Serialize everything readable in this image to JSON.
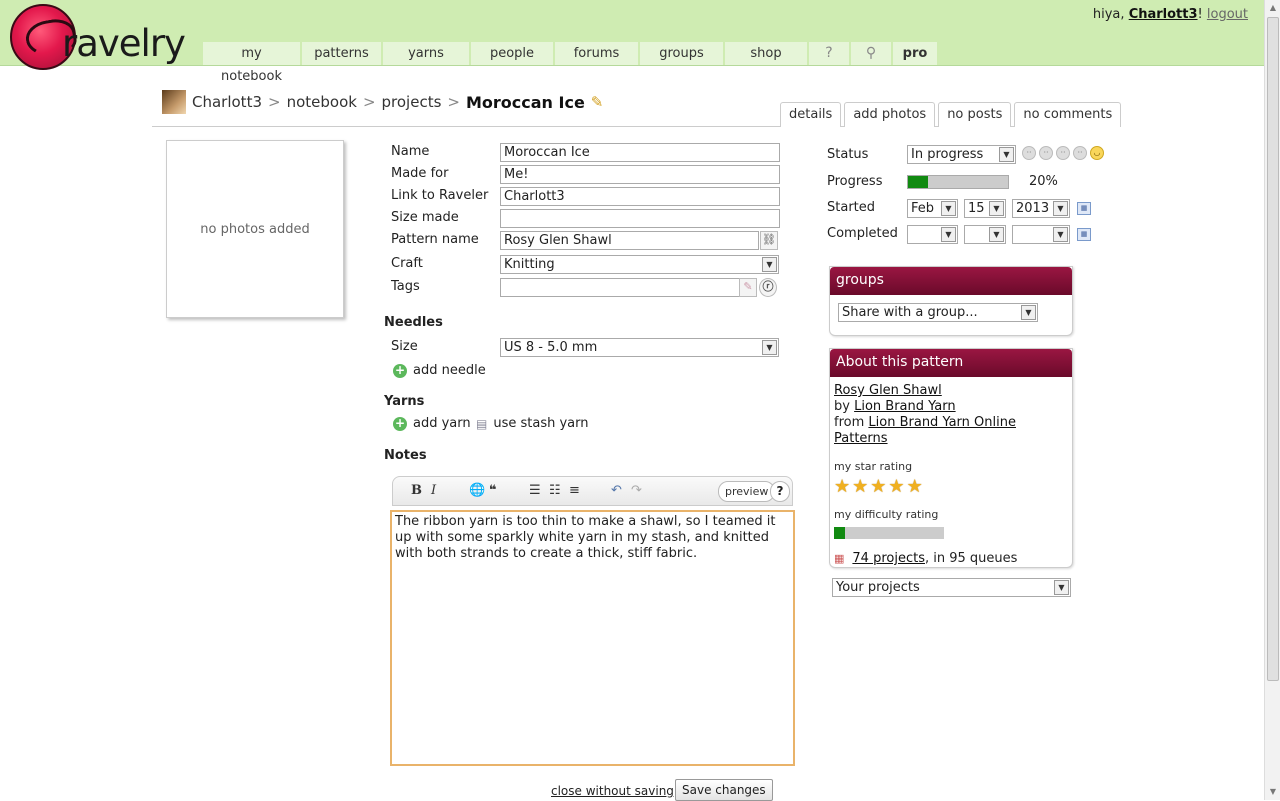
{
  "header": {
    "logo_text": "ravelry",
    "nav": [
      "my notebook",
      "patterns",
      "yarns",
      "people",
      "forums",
      "groups",
      "shop",
      "?",
      "⚲",
      "pro"
    ],
    "greeting": "hiya,",
    "username": "Charlott3",
    "exclaim": "!",
    "logout": "logout"
  },
  "breadcrumb": {
    "user": "Charlott3",
    "notebook": "notebook",
    "projects": "projects",
    "current": "Moroccan Ice",
    "sep": ">"
  },
  "subtabs": [
    "details",
    "add photos",
    "no posts",
    "no comments"
  ],
  "photos": {
    "empty": "no photos added"
  },
  "form": {
    "name_label": "Name",
    "name_value": "Moroccan Ice",
    "madefor_label": "Made for",
    "madefor_value": "Me!",
    "link_label": "Link to Raveler",
    "link_value": "Charlott3",
    "size_label": "Size made",
    "size_value": "",
    "pattern_label": "Pattern name",
    "pattern_value": "Rosy Glen Shawl",
    "craft_label": "Craft",
    "craft_value": "Knitting",
    "tags_label": "Tags",
    "tags_value": ""
  },
  "needles": {
    "heading": "Needles",
    "size_label": "Size",
    "size_value": "US 8 - 5.0 mm",
    "add": "add needle"
  },
  "yarns": {
    "heading": "Yarns",
    "add": "add yarn",
    "stash": "use stash yarn"
  },
  "notes": {
    "heading": "Notes",
    "text": "The ribbon yarn is too thin to make a shawl, so I teamed it up with some sparkly white yarn in my stash, and knitted with both strands to create a thick, stiff fabric.",
    "preview": "preview",
    "help": "?"
  },
  "actions": {
    "close": "close without saving",
    "save": "Save changes"
  },
  "status": {
    "status_label": "Status",
    "status_value": "In progress",
    "progress_label": "Progress",
    "progress_value": 20,
    "progress_text": "20%",
    "started_label": "Started",
    "started_month": "Feb",
    "started_day": "15",
    "started_year": "2013",
    "completed_label": "Completed"
  },
  "groups": {
    "title": "groups",
    "select": "Share with a group..."
  },
  "about": {
    "title": "About this pattern",
    "pattern": "Rosy Glen Shawl",
    "by": "by",
    "designer": "Lion Brand Yarn",
    "from": "from",
    "source": "Lion Brand Yarn Online Patterns",
    "star_label": "my star rating",
    "stars": 5,
    "difficulty_label": "my difficulty rating",
    "difficulty": 0.1,
    "projects_link": "74 projects",
    "queues": ", in 95 queues"
  },
  "your_projects": "Your projects"
}
